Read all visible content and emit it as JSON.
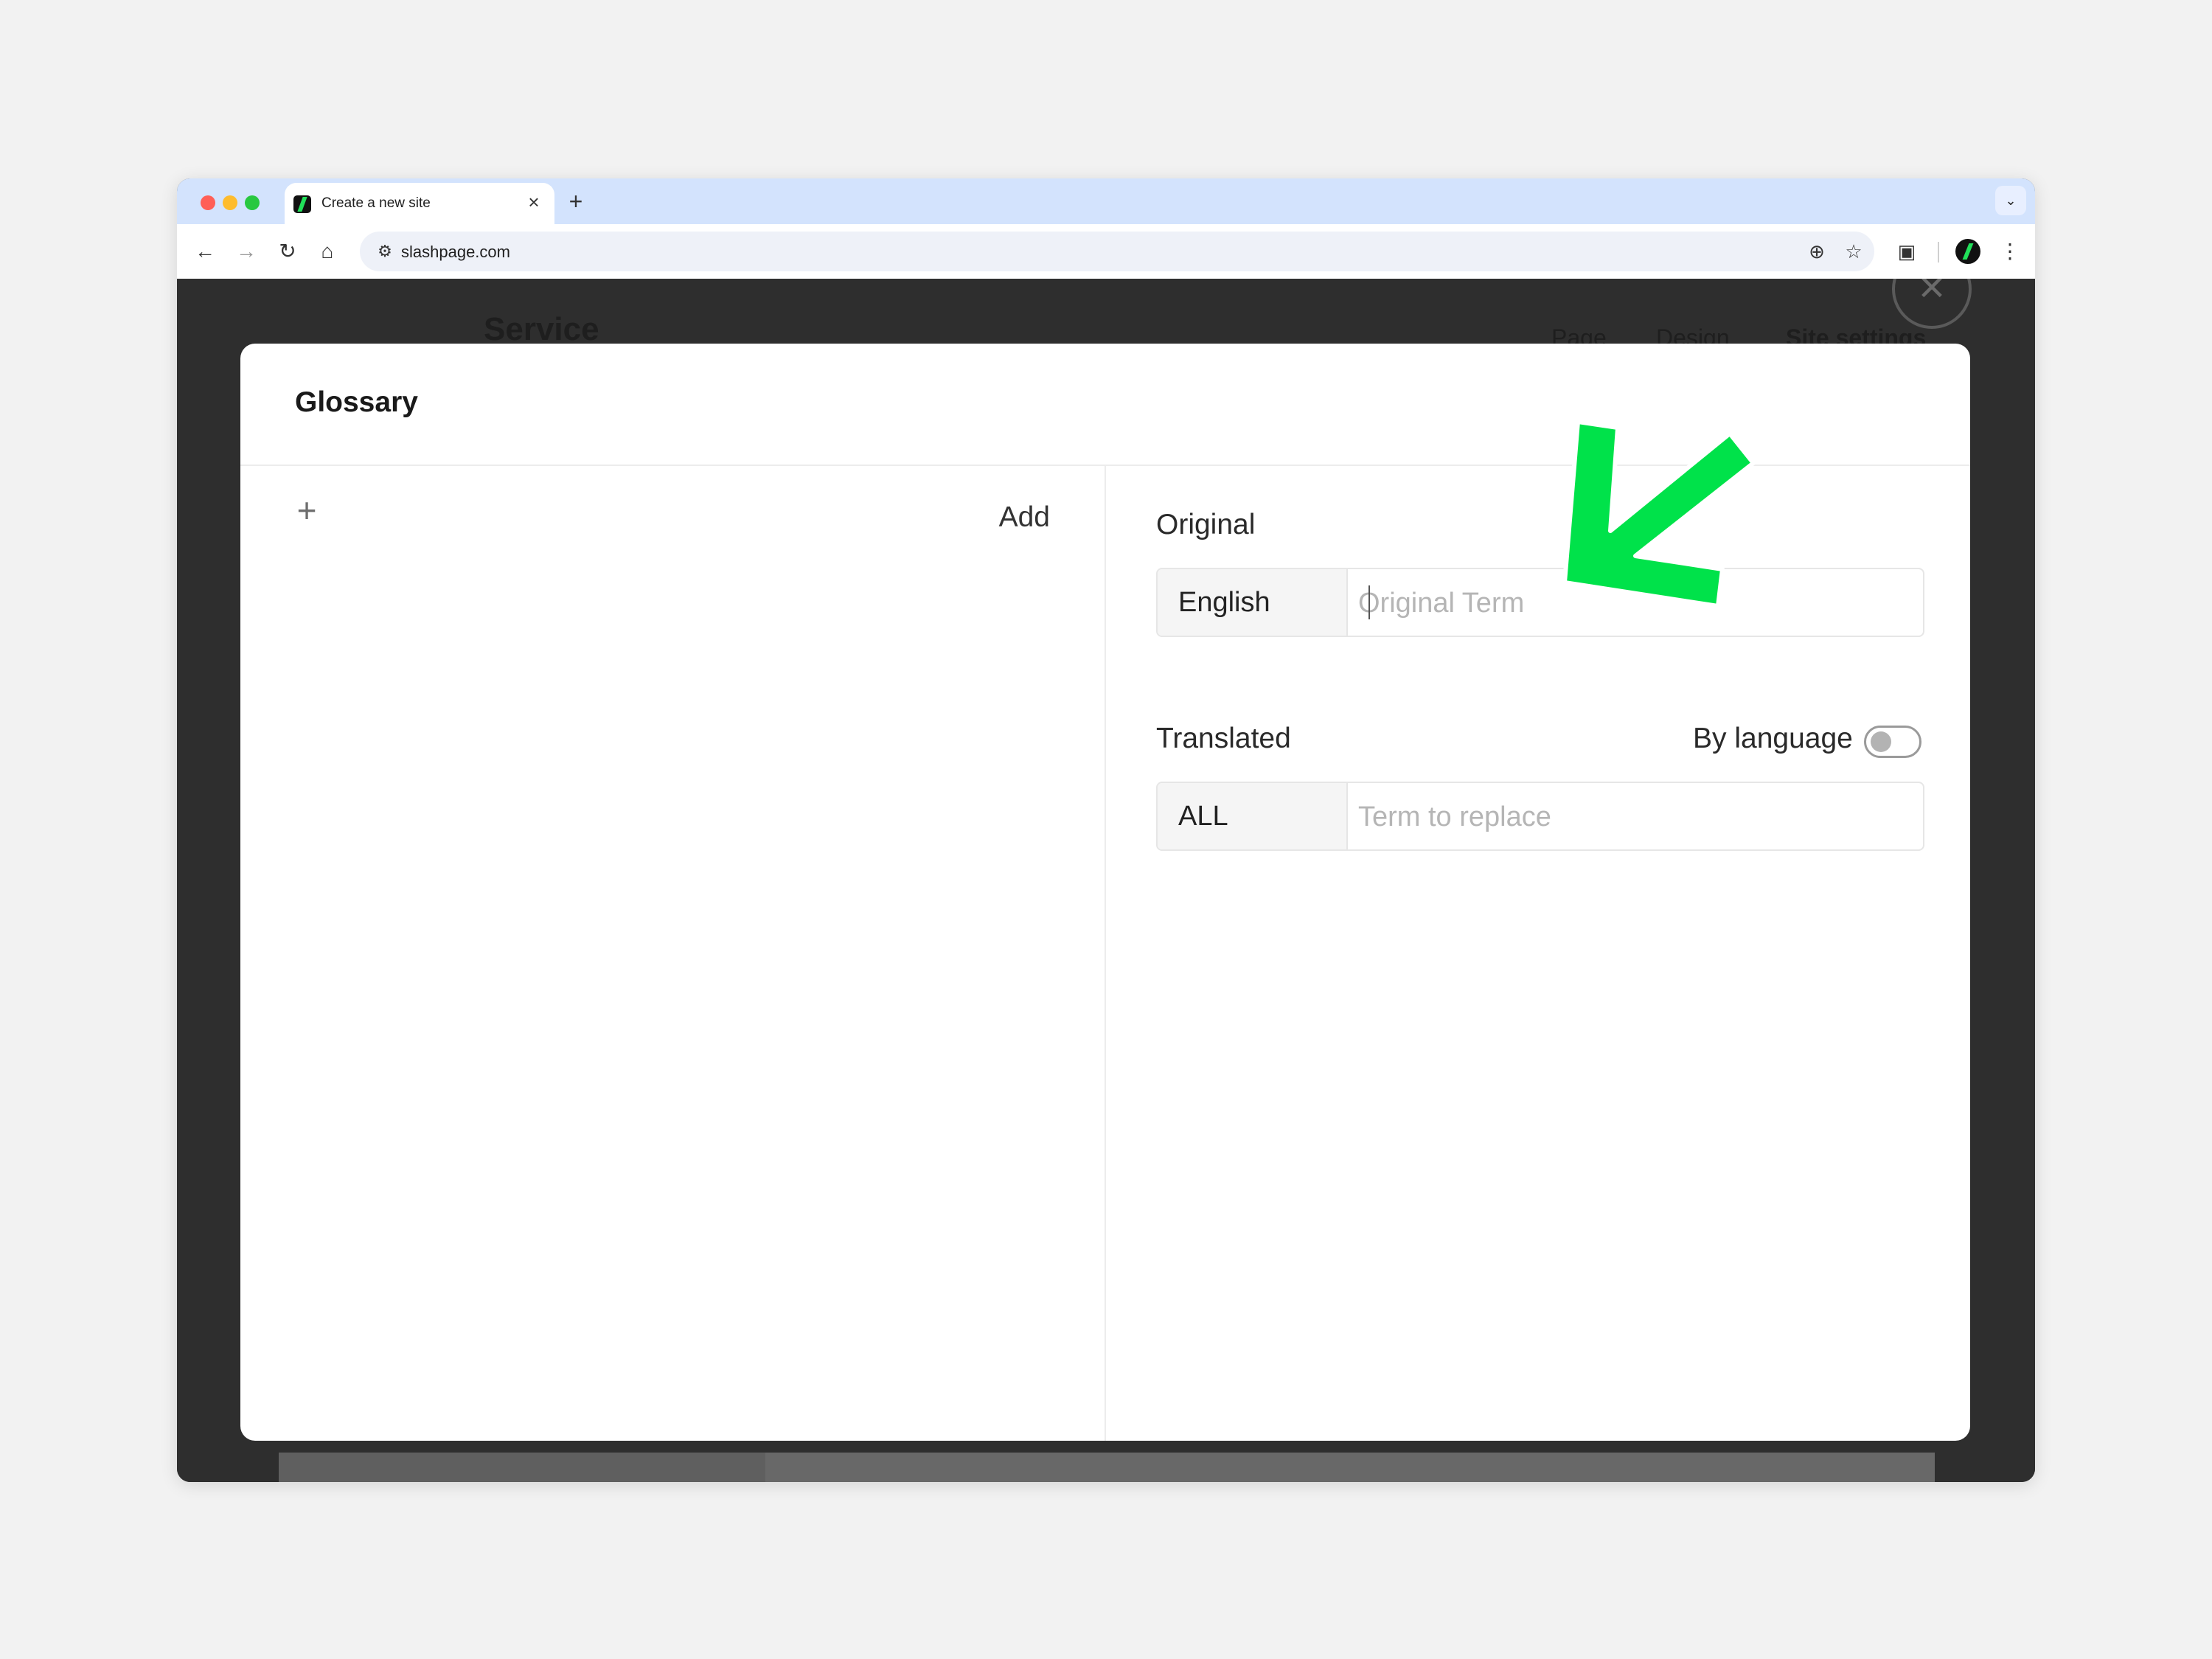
{
  "browser": {
    "tab_title": "Create a new site",
    "tab_close": "×",
    "new_tab": "+",
    "url": "slashpage.com"
  },
  "background": {
    "app_name": "Service",
    "nav": [
      "Page",
      "Design",
      "Site settings"
    ]
  },
  "modal": {
    "title": "Glossary",
    "add_label": "Add",
    "plus_symbol": "+",
    "original": {
      "label": "Original",
      "language": "English",
      "placeholder": "Original Term"
    },
    "translated": {
      "label": "Translated",
      "by_language_label": "By language",
      "by_language_enabled": false,
      "language": "ALL",
      "placeholder": "Term to replace"
    }
  },
  "annotation": {
    "arrow_color": "#00e24a"
  },
  "colors": {
    "tabstrip": "#d3e3fd",
    "overlay": "#2e2e2e",
    "accent_green": "#21e05a"
  }
}
